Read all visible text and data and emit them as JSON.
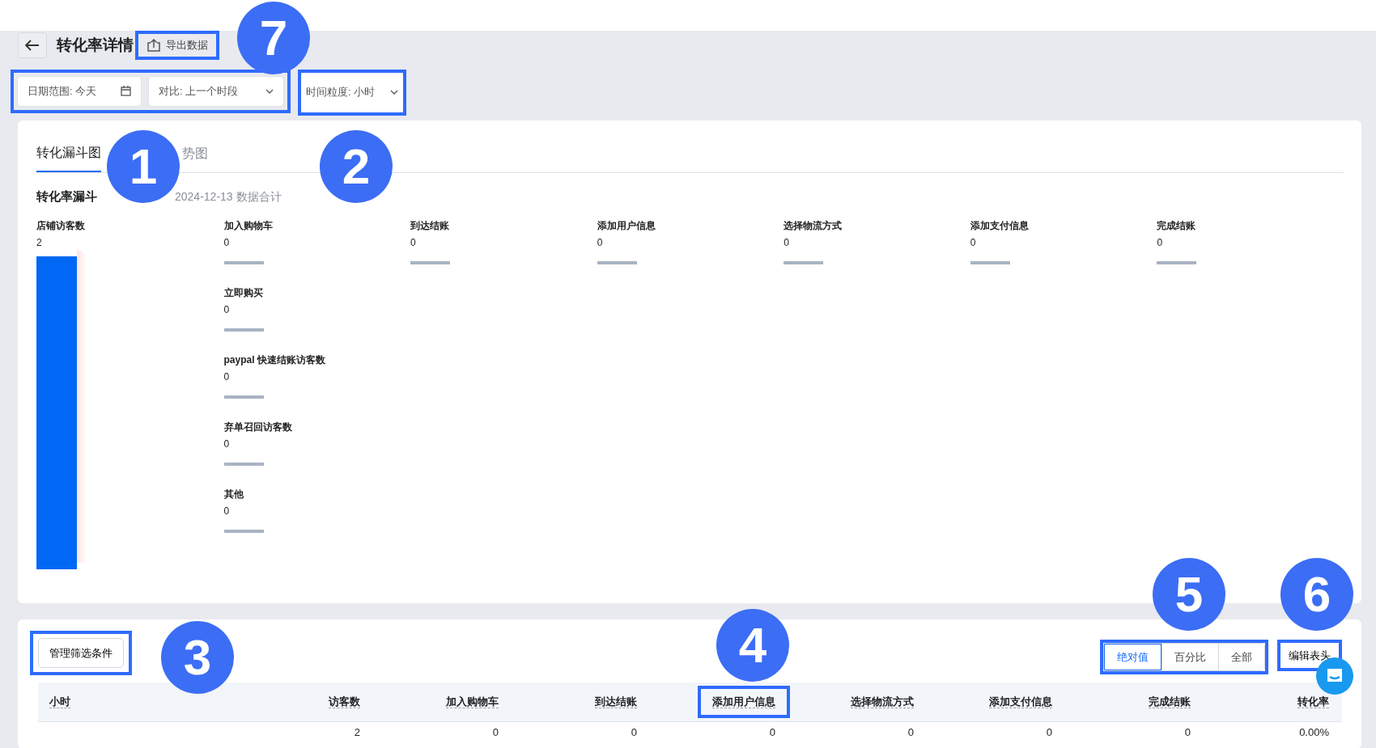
{
  "header": {
    "title": "转化率详情",
    "export_button": "导出数据",
    "export_callout": "7"
  },
  "filters": {
    "date_range": "日期范围: 今天",
    "compare": "对比: 上一个时段",
    "callout": "1",
    "granularity": "时间粒度: 小时",
    "granularity_callout": "2"
  },
  "tabs": [
    {
      "label": "转化漏斗图",
      "selected": true
    },
    {
      "label": "势图",
      "selected": false
    }
  ],
  "funnel": {
    "title": "转化率漏斗",
    "subtitle": "2024-12-13 数据合计",
    "entry": {
      "label": "店铺访客数",
      "value": "2"
    },
    "stages": [
      {
        "steps": [
          {
            "label": "加入购物车",
            "value": "0"
          },
          {
            "label": "立即购买",
            "value": "0"
          },
          {
            "label": "paypal 快速结账访客数",
            "value": "0"
          },
          {
            "label": "弃单召回访客数",
            "value": "0"
          },
          {
            "label": "其他",
            "value": "0"
          }
        ]
      },
      {
        "steps": [
          {
            "label": "到达结账",
            "value": "0"
          }
        ]
      },
      {
        "steps": [
          {
            "label": "添加用户信息",
            "value": "0"
          }
        ]
      },
      {
        "steps": [
          {
            "label": "选择物流方式",
            "value": "0"
          }
        ]
      },
      {
        "steps": [
          {
            "label": "添加支付信息",
            "value": "0"
          }
        ]
      },
      {
        "steps": [
          {
            "label": "完成结账",
            "value": "0"
          }
        ]
      }
    ]
  },
  "table_toolbar": {
    "filter_button": "管理筛选条件",
    "filter_callout": "3",
    "view_modes": [
      {
        "label": "绝对值",
        "selected": true
      },
      {
        "label": "百分比",
        "selected": false
      },
      {
        "label": "全部",
        "selected": false
      }
    ],
    "view_modes_callout": "5",
    "edit_button": "编辑表头",
    "edit_callout": "6"
  },
  "table": {
    "columns": [
      {
        "label": "小时"
      },
      {
        "label": "访客数"
      },
      {
        "label": "加入购物车"
      },
      {
        "label": "到达结账"
      },
      {
        "label": "添加用户信息",
        "callout": "4"
      },
      {
        "label": "选择物流方式"
      },
      {
        "label": "添加支付信息"
      },
      {
        "label": "完成结账"
      },
      {
        "label": "转化率"
      }
    ],
    "rows": [
      {
        "values": [
          "2",
          "0",
          "0",
          "0",
          "0",
          "0",
          "0",
          "0.00%"
        ]
      }
    ]
  }
}
